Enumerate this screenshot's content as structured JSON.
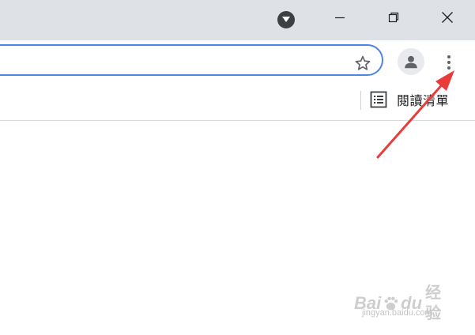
{
  "titlebar": {
    "tab_search_icon": "caret-down-circle-icon",
    "minimize_icon": "minimize-icon",
    "restore_icon": "restore-icon",
    "close_icon": "close-icon"
  },
  "toolbar": {
    "omnibox_value": "",
    "bookmark_star_icon": "star-outline-icon",
    "profile_icon": "person-icon",
    "menu_icon": "more-vertical-icon"
  },
  "bookmarks_bar": {
    "reading_list_icon": "reading-list-icon",
    "reading_list_label": "閱讀清單"
  },
  "annotation": {
    "arrow_color": "#ea3b3b"
  },
  "watermark": {
    "logo_text_1": "Bai",
    "logo_text_2": "du",
    "logo_suffix": "经验",
    "url": "jingyan.baidu.com"
  },
  "colors": {
    "titlebar_bg": "#dee1e6",
    "omnibox_border": "#4a86e2",
    "icon_gray": "#5f6368"
  }
}
